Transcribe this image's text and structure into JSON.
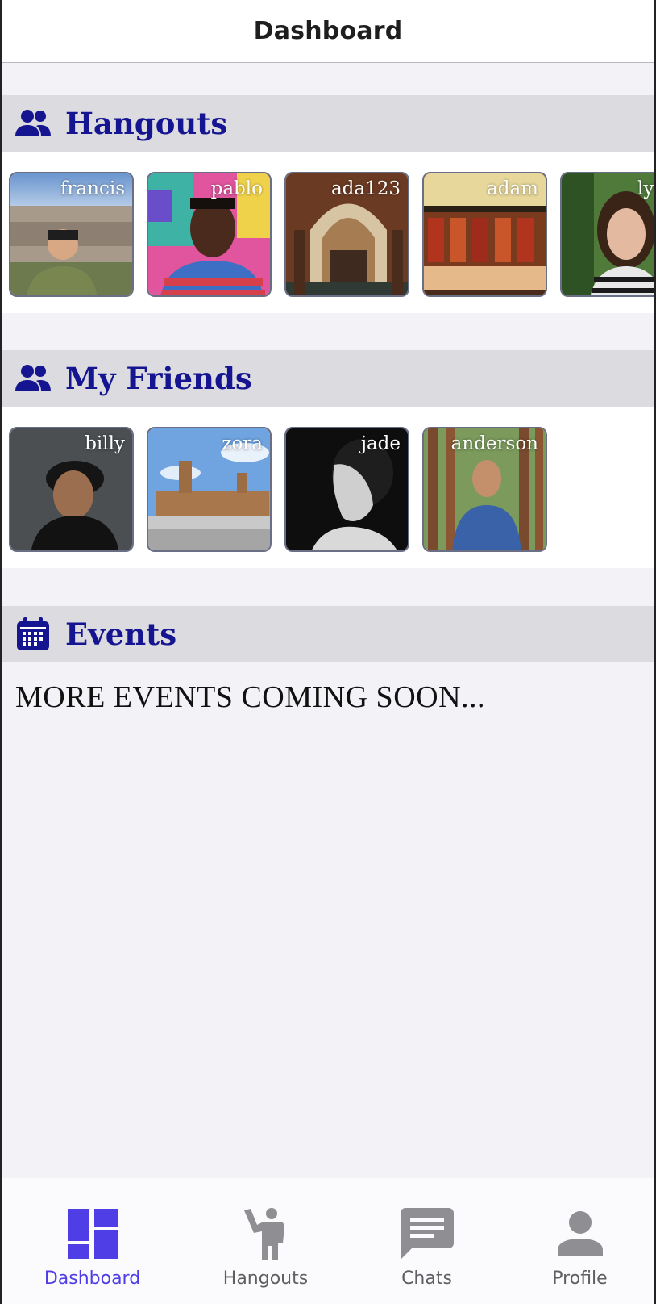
{
  "navbar": {
    "title": "Dashboard"
  },
  "sections": {
    "hangouts": {
      "title": "Hangouts",
      "icon": "people-icon"
    },
    "friends": {
      "title": "My Friends",
      "icon": "people-icon"
    },
    "events": {
      "title": "Events",
      "icon": "calendar-icon",
      "message": "MORE EVENTS COMING SOON..."
    }
  },
  "hangouts": [
    {
      "username": "francis"
    },
    {
      "username": "pablo"
    },
    {
      "username": "ada123"
    },
    {
      "username": "adam"
    },
    {
      "username": "ly"
    }
  ],
  "friends": [
    {
      "username": "billy"
    },
    {
      "username": "zora"
    },
    {
      "username": "jade"
    },
    {
      "username": "anderson"
    }
  ],
  "tabbar": {
    "items": [
      {
        "label": "Dashboard",
        "icon": "dashboard-icon",
        "active": true
      },
      {
        "label": "Hangouts",
        "icon": "person-waving-icon",
        "active": false
      },
      {
        "label": "Chats",
        "icon": "chat-bubble-icon",
        "active": false
      },
      {
        "label": "Profile",
        "icon": "person-icon",
        "active": false
      }
    ]
  },
  "colors": {
    "accent": "#4f3ee6",
    "section_title": "#151591",
    "tab_inactive": "#5f5f63"
  }
}
